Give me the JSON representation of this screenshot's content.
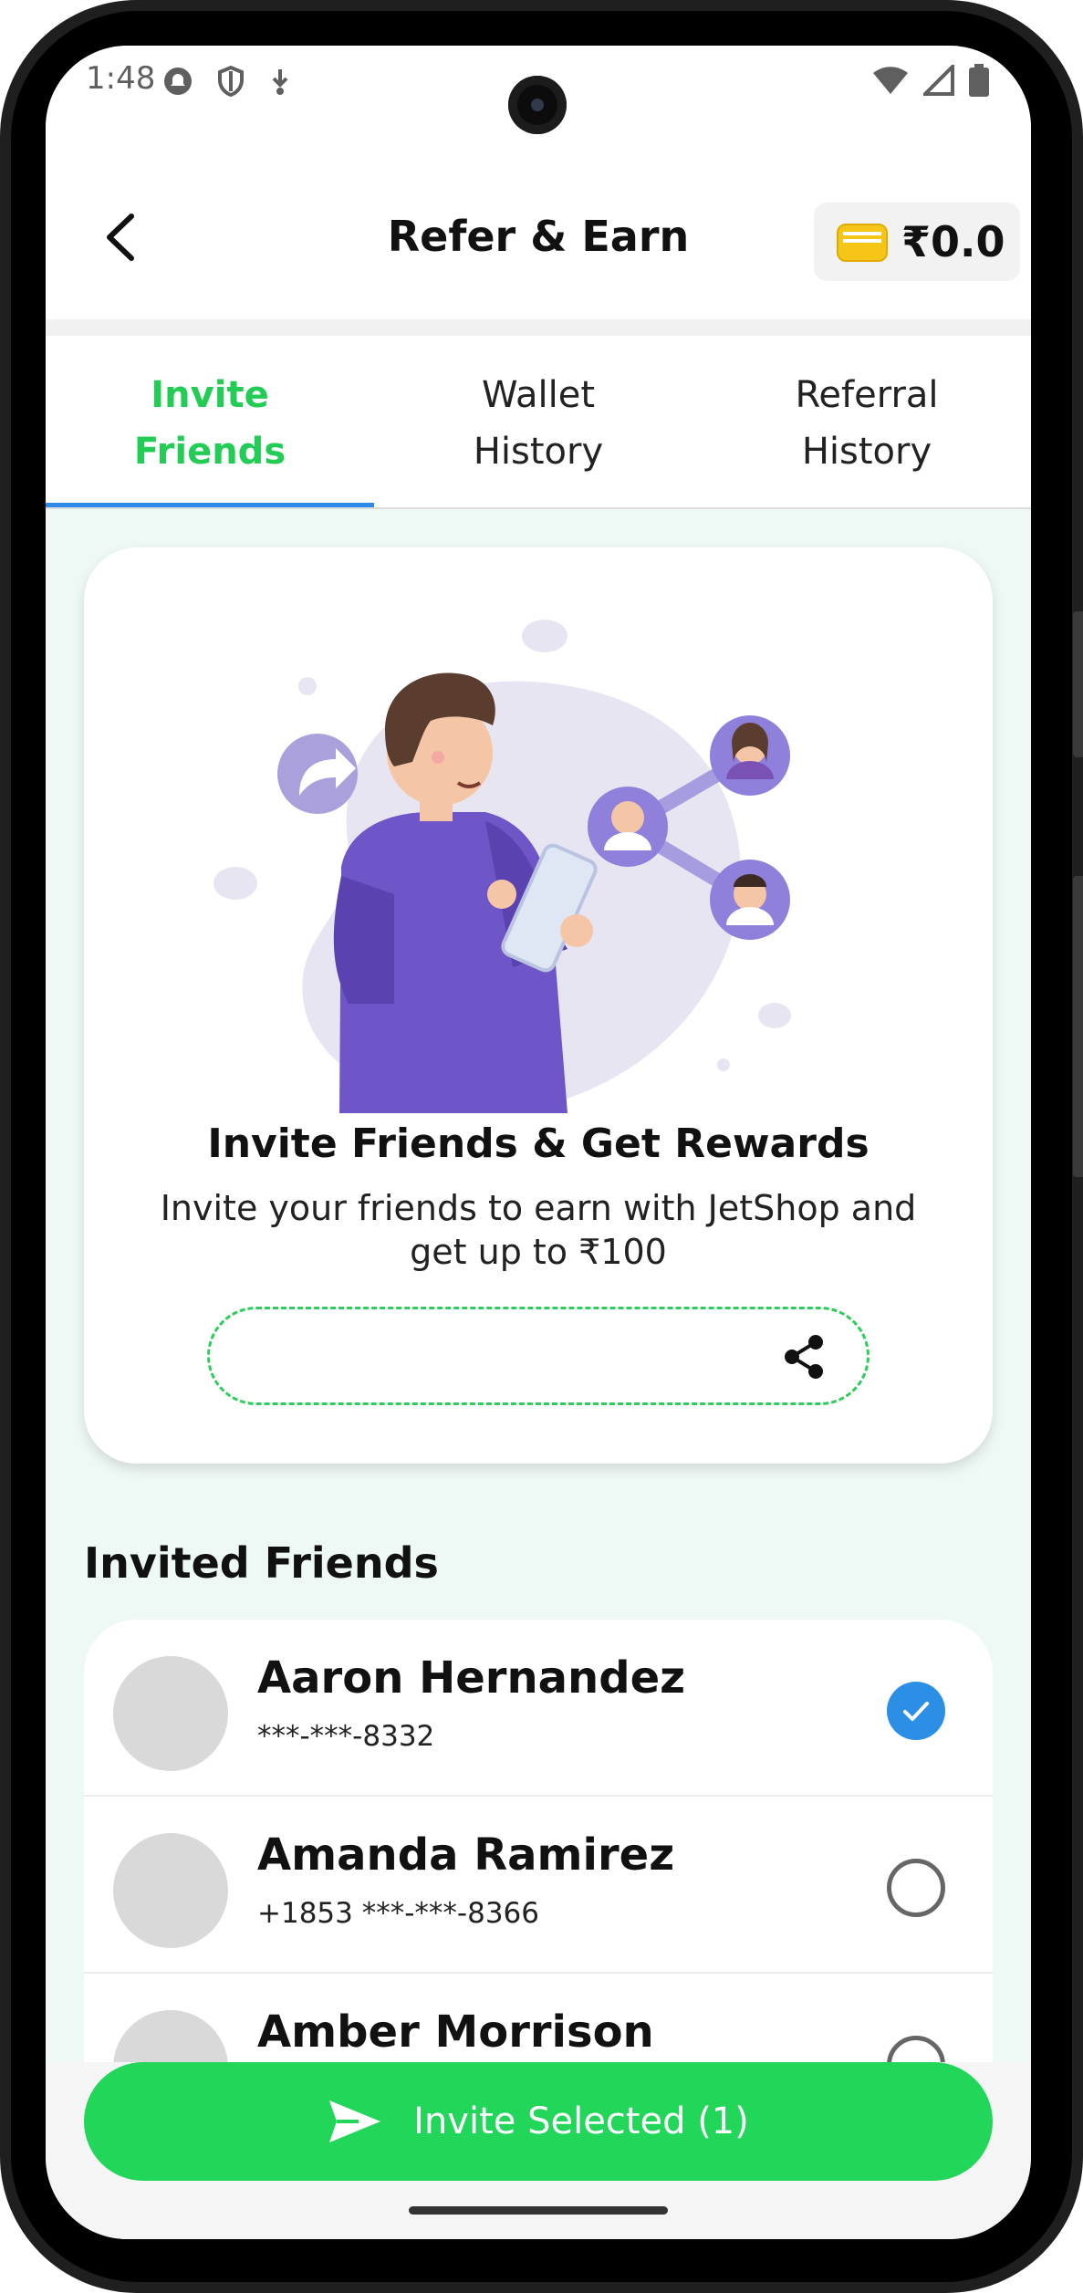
{
  "status_bar": {
    "time": "1:48"
  },
  "header": {
    "title": "Refer & Earn",
    "wallet_amount": "₹0.0"
  },
  "tabs": [
    {
      "line1": "Invite",
      "line2": "Friends",
      "active": true
    },
    {
      "line1": "Wallet",
      "line2": "History",
      "active": false
    },
    {
      "line1": "Referral",
      "line2": "History",
      "active": false
    }
  ],
  "invite_card": {
    "title": "Invite Friends & Get Rewards",
    "description": "Invite your friends to earn with JetShop and get up to ₹100",
    "referral_code": ""
  },
  "invited_section": {
    "title": "Invited Friends"
  },
  "friends": [
    {
      "name": "Aaron Hernandez",
      "phone": "***-***-8332",
      "selected": true
    },
    {
      "name": "Amanda Ramirez",
      "phone": "+1853 ***-***-8366",
      "selected": false
    },
    {
      "name": "Amber Morrison",
      "phone": "",
      "selected": false
    }
  ],
  "invite_button": {
    "label": "Invite Selected (1)"
  },
  "colors": {
    "accent_green": "#22d65a",
    "tab_active": "#22cc55",
    "tab_indicator": "#2d8ae8",
    "check_blue": "#2b8fe6"
  }
}
